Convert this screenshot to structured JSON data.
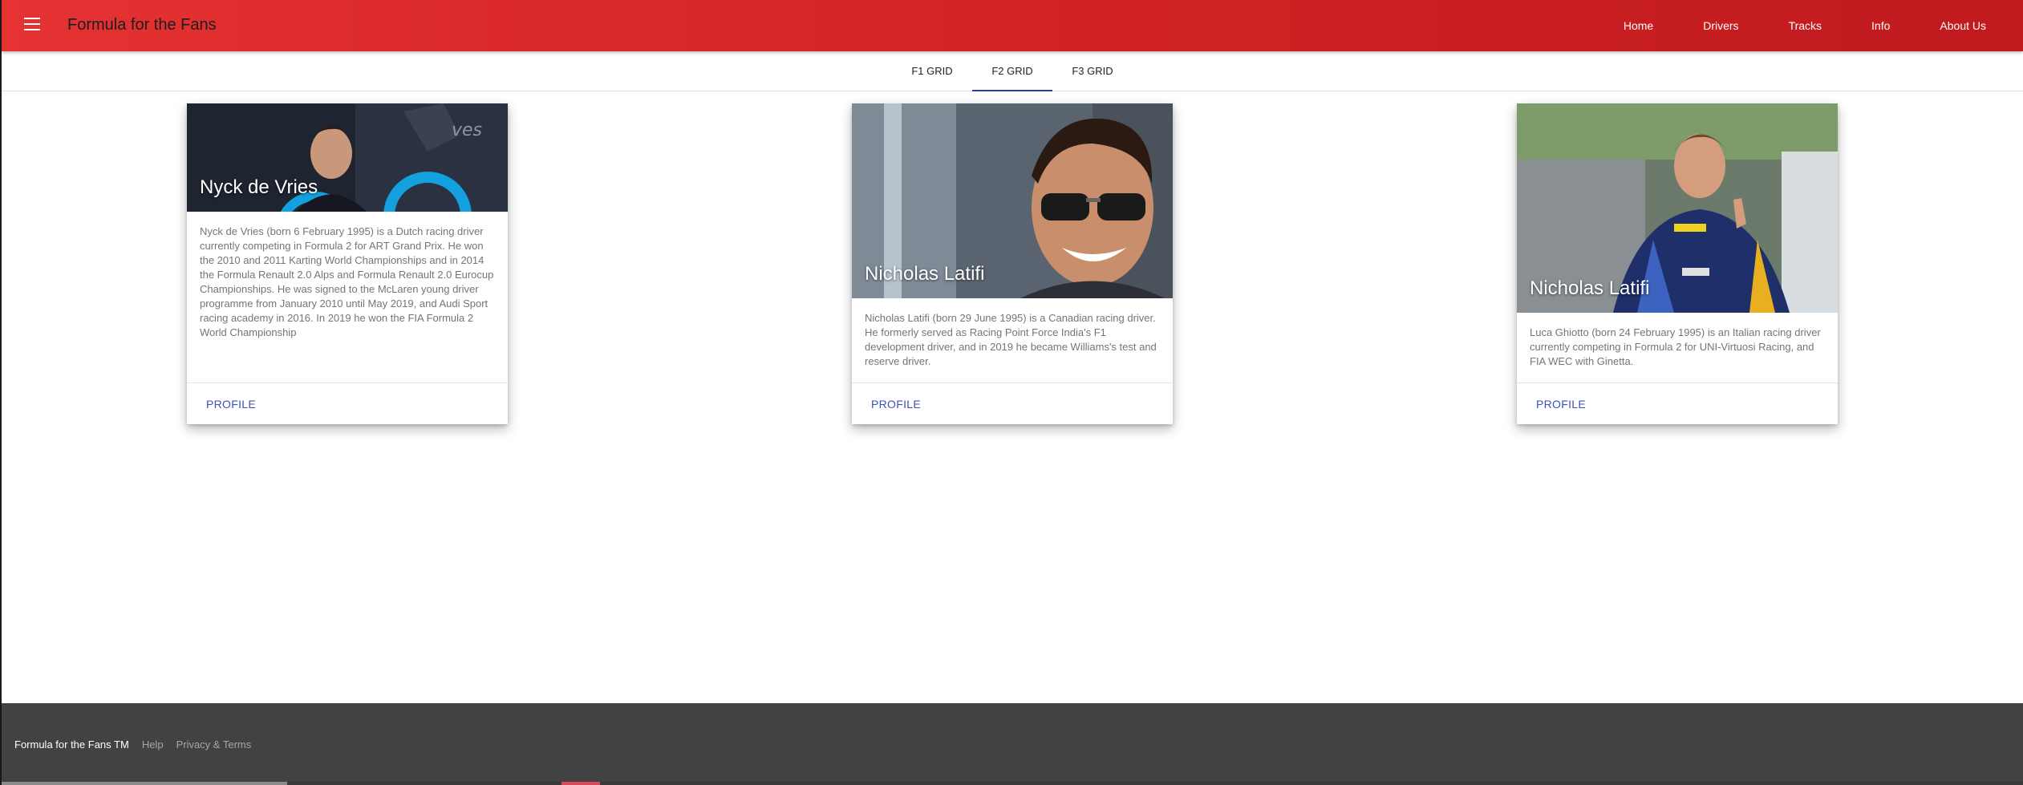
{
  "header": {
    "title": "Formula for the Fans",
    "nav": [
      "Home",
      "Drivers",
      "Tracks",
      "Info",
      "About Us"
    ]
  },
  "tabs": [
    "F1 GRID",
    "F2 GRID",
    "F3 GRID"
  ],
  "active_tab": "F2 GRID",
  "cards": [
    {
      "name": "Nyck de Vries",
      "description": "Nyck de Vries (born 6 February 1995) is a Dutch racing driver currently competing in Formula 2 for ART Grand Prix. He won the 2010 and 2011 Karting World Championships and in 2014 the Formula Renault 2.0 Alps and Formula Renault 2.0 Eurocup Championships. He was signed to the McLaren young driver programme from January 2010 until May 2019, and Audi Sport racing academy in 2016. In 2019 he won the FIA Formula 2 World Championship",
      "action": "PROFILE"
    },
    {
      "name": "Nicholas Latifi",
      "description": "Nicholas Latifi (born 29 June 1995) is a Canadian racing driver. He formerly served as Racing Point Force India's F1 development driver, and in 2019 he became Williams's test and reserve driver.",
      "action": "PROFILE"
    },
    {
      "name": "Nicholas Latifi",
      "description": "Luca Ghiotto (born 24 February 1995) is an Italian racing driver currently competing in Formula 2 for UNI-Virtuosi Racing, and FIA WEC with Ginetta.",
      "action": "PROFILE"
    }
  ],
  "footer": {
    "brand": "Formula for the Fans TM",
    "links": [
      "Help",
      "Privacy & Terms"
    ]
  },
  "colors": {
    "appbar": "#d42424",
    "accent": "#3f51b5",
    "footer": "#424242"
  }
}
